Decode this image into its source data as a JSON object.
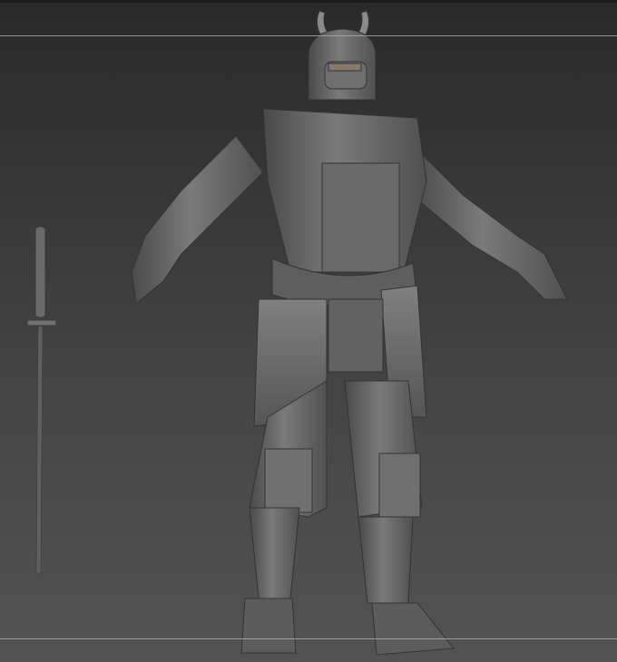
{
  "viewport": {
    "background_top": "#2a2a2a",
    "background_bottom": "#535353",
    "guide_color": "#a8a8a8",
    "model_color": "#6e6e6e"
  }
}
